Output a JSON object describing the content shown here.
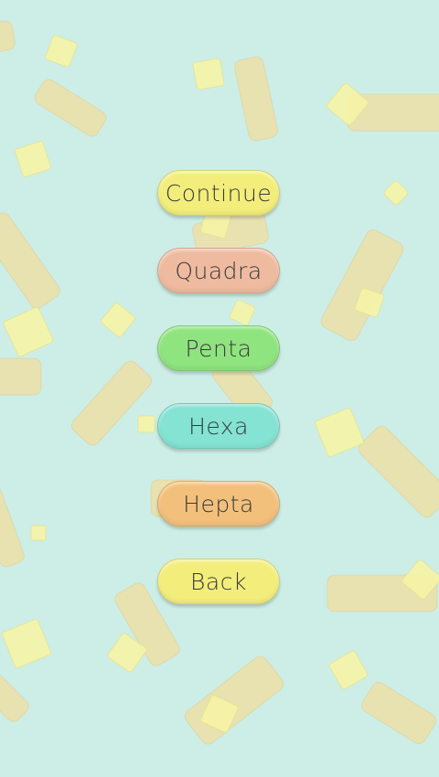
{
  "background": {
    "color": "#cdeee6",
    "stick_color": "#ecdfa7",
    "tile_color": "#f6f4a6"
  },
  "menu": {
    "buttons": [
      {
        "id": "continue",
        "label": "Continue",
        "color": "#f3ee7c"
      },
      {
        "id": "quadra",
        "label": "Quadra",
        "color": "#efbba0"
      },
      {
        "id": "penta",
        "label": "Penta",
        "color": "#8fe47f"
      },
      {
        "id": "hexa",
        "label": "Hexa",
        "color": "#84e3d3"
      },
      {
        "id": "hepta",
        "label": "Hepta",
        "color": "#f3c07c"
      },
      {
        "id": "back",
        "label": "Back",
        "color": "#f3ee7c"
      }
    ]
  }
}
